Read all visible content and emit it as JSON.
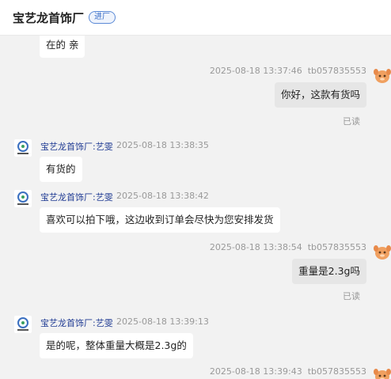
{
  "header": {
    "shop_name": "宝艺龙首饰厂",
    "tag": "进厂"
  },
  "messages": [
    {
      "side": "agent",
      "text": "在的 亲"
    },
    {
      "side": "user",
      "time": "2025-08-18 13:37:46",
      "user": "tb057835553",
      "text": "你好，这款有货吗",
      "status": "已读"
    },
    {
      "side": "agent",
      "name": "宝艺龙首饰厂:艺雯",
      "time": "2025-08-18 13:38:35",
      "text": "有货的"
    },
    {
      "side": "agent",
      "name": "宝艺龙首饰厂:艺雯",
      "time": "2025-08-18 13:38:42",
      "text": "喜欢可以拍下哦，这边收到订单会尽快为您安排发货"
    },
    {
      "side": "user",
      "time": "2025-08-18 13:38:54",
      "user": "tb057835553",
      "text": "重量是2.3g吗",
      "status": "已读"
    },
    {
      "side": "agent",
      "name": "宝艺龙首饰厂:艺雯",
      "time": "2025-08-18 13:39:13",
      "text": "是的呢，整体重量大概是2.3g的"
    },
    {
      "side": "user",
      "time": "2025-08-18 13:39:43",
      "user": "tb057835553"
    }
  ],
  "colors": {
    "background": "#f2f2f2",
    "agent_bubble": "#ffffff",
    "user_bubble": "#e6e6e6",
    "agent_name": "#1f3a93",
    "meta": "#999999",
    "avatar_user": "#f0a060"
  },
  "icons": {
    "shop_avatar": "shop-logo-icon",
    "user_avatar": "user-avatar-icon"
  }
}
